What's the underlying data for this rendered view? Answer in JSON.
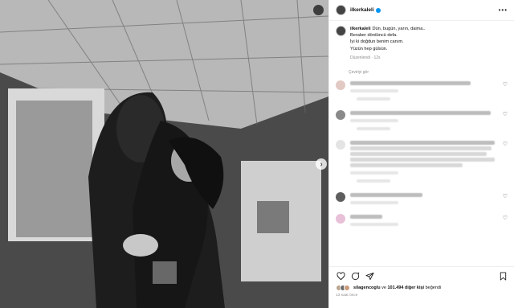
{
  "post": {
    "username": "ilkerkaleli",
    "more_icon": "more-horizontal-icon"
  },
  "caption": {
    "username": "ilkerkaleli",
    "line1": "Dün, bugün, yarın, daima..",
    "line2": "Beraber dördüncü defa.",
    "line3": "İyi ki doğdun benim canım.",
    "line4": "Yüzün hep gülsün.",
    "meta": "Düzenlendi · 12s",
    "translate": "Çeviriyi gör"
  },
  "comments": [
    {
      "id": 1
    },
    {
      "id": 2
    },
    {
      "id": 3
    },
    {
      "id": 4
    },
    {
      "id": 5
    }
  ],
  "likes": {
    "user": "silagencoglu",
    "connector": "ve",
    "count": "101.494 diğer kişi",
    "suffix": "beğendi",
    "time": "13 saat önce"
  },
  "icons": [
    "heart-icon",
    "comment-icon",
    "share-icon",
    "save-icon"
  ]
}
